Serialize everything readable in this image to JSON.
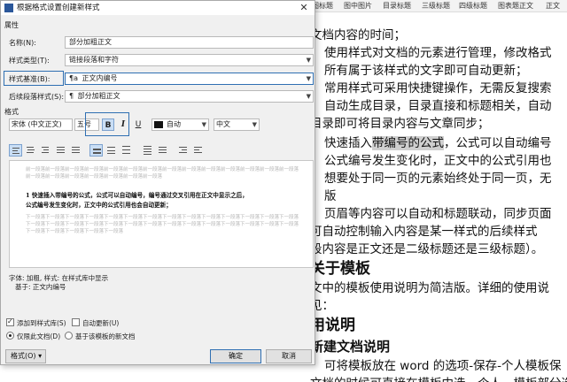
{
  "document": {
    "ribbon_styles": [
      "图标题",
      "图中图片",
      "目录标题",
      "三级标题",
      "四级标题",
      "图表题正文",
      "正文"
    ],
    "lines": [
      {
        "text": "文档内容的时间；",
        "style": "normal"
      },
      {
        "text": "使用样式对文档的元素进行管理，修改格式",
        "style": "normal"
      },
      {
        "text": "所有属于该样式的文字即可自动更新；",
        "style": "normal"
      },
      {
        "text": "常用样式可采用快捷键操作，无需反复搜索",
        "style": "normal"
      },
      {
        "text": "自动生成目录，目录直接和标题相关，自动",
        "style": "normal"
      },
      {
        "text": "目录即可将目录内容与文章同步；",
        "style": "normal"
      },
      {
        "text_before": "快速插入",
        "highlight": "带编号的公式",
        "text_after": "，公式可以自动编号",
        "style": "highlight"
      },
      {
        "text": "公式编号发生变化时，正文中的公式引用也",
        "style": "normal"
      },
      {
        "text": "想要处于同一页的元素始终处于同一页，无",
        "style": "normal"
      },
      {
        "text": "版",
        "style": "normal"
      },
      {
        "text": "页眉等内容可以自动和标题联动，同步页面",
        "style": "normal"
      },
      {
        "text": "可自动控制输入内容是某一样式的后续样式",
        "style": "normal"
      },
      {
        "text": "段内容是正文还是二级标题还是三级标题）。",
        "style": "normal"
      },
      {
        "text": "关于模板",
        "style": "h2"
      },
      {
        "text": "文中的模板使用说明为简洁版。详细的使用说",
        "style": "normal"
      },
      {
        "text": "见：",
        "style": "normal"
      },
      {
        "text": "用说明",
        "style": "h2"
      },
      {
        "text": "新建文档说明",
        "style": "h3"
      },
      {
        "text": "可将模板放在 word 的选项-保存-个人模板保",
        "style": "normal"
      },
      {
        "text": "文档的时候可直接在模板中选，个人，模板部分选",
        "style": "normal"
      }
    ]
  },
  "dialog": {
    "title": "根据格式设置创建新样式",
    "close_glyph": "✕",
    "properties_heading": "属性",
    "name_label": "名称(N):",
    "name_value": "部分加粗正文",
    "style_type_label": "样式类型(T):",
    "style_type_value": "链接段落和字符",
    "based_on_label": "样式基准(B):",
    "based_on_value": "正文内编号",
    "based_on_icon": "¶a",
    "following_label": "后续段落样式(S):",
    "following_value": "部分加粗正文",
    "following_icon": "¶",
    "format_heading": "格式",
    "font_value": "宋体 (中文正文)",
    "size_value": "五号",
    "bold_glyph": "B",
    "italic_glyph": "I",
    "underline_glyph": "U",
    "color_value": "自动",
    "script_value": "中文",
    "preview_prev": "前一段落前一段落前一段落前一段落前一段落前一段落前一段落前一段落前一段落前一段落前一段落前一段落前一段落前一段落前一段落前一段落前一段落前一段落前一段落前一段落前一段落",
    "preview_main_line1": "1    快速插入带编号的公式，公式可以自动编号，编号通过交叉引用在正文中显示之后，",
    "preview_main_line2": "公式编号发生变化时，正文中的公式引用也会自动更新；",
    "preview_next": "下一段落下一段落下一段落下一段落下一段落下一段落下一段落下一段落下一段落下一段落下一段落下一段落下一段落下一段落下一段落下一段落下一段落下一段落下一段落下一段落下一段落下一段落下一段落下一段落下一段落下一段落下一段落下一段落下一段落下一段落下一段落下一段落下一段落",
    "description_line1": "字体: 加粗, 样式: 在样式库中显示",
    "description_line2": "基于: 正文内编号",
    "add_to_gallery_label": "添加到样式库(S)",
    "add_to_gallery_checked": true,
    "auto_update_label": "自动更新(U)",
    "auto_update_checked": false,
    "only_this_doc_label": "仅限此文档(D)",
    "new_docs_label": "基于该模板的新文档",
    "format_button": "格式(O)",
    "format_arrow": "▾",
    "ok_button": "确定",
    "cancel_button": "取消"
  }
}
